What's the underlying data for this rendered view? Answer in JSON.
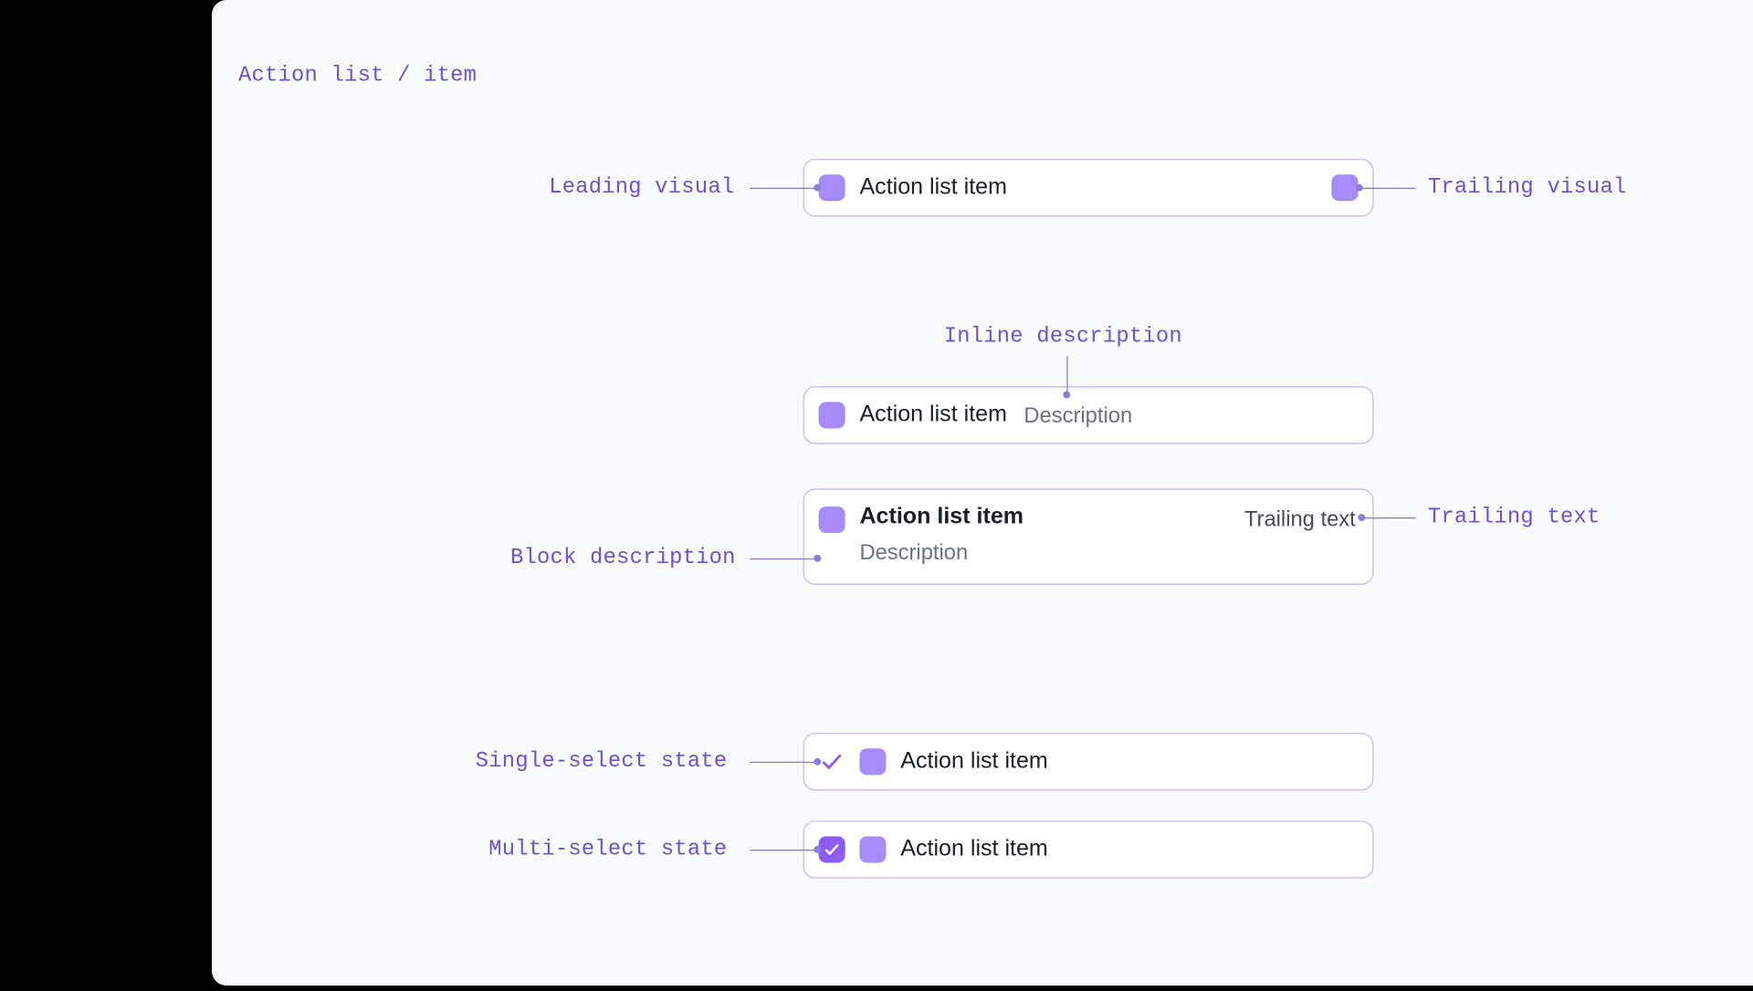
{
  "title": "Action list / item",
  "annotations": {
    "leading_visual": "Leading visual",
    "trailing_visual": "Trailing visual",
    "inline_description": "Inline description",
    "block_description": "Block description",
    "trailing_text": "Trailing text",
    "single_select": "Single-select state",
    "multi_select": "Multi-select state"
  },
  "items": {
    "basic": {
      "label": "Action list item"
    },
    "inline": {
      "label": "Action list item",
      "description": "Description"
    },
    "block": {
      "label": "Action list item",
      "description": "Description",
      "trailing_text": "Trailing text"
    },
    "single_select": {
      "label": "Action list item"
    },
    "multi_select": {
      "label": "Action list item"
    }
  },
  "colors": {
    "accent": "#8B5CF6",
    "swatch": "#A78BFA",
    "annotation": "#6E4FD6",
    "border": "#CBB8F5"
  }
}
